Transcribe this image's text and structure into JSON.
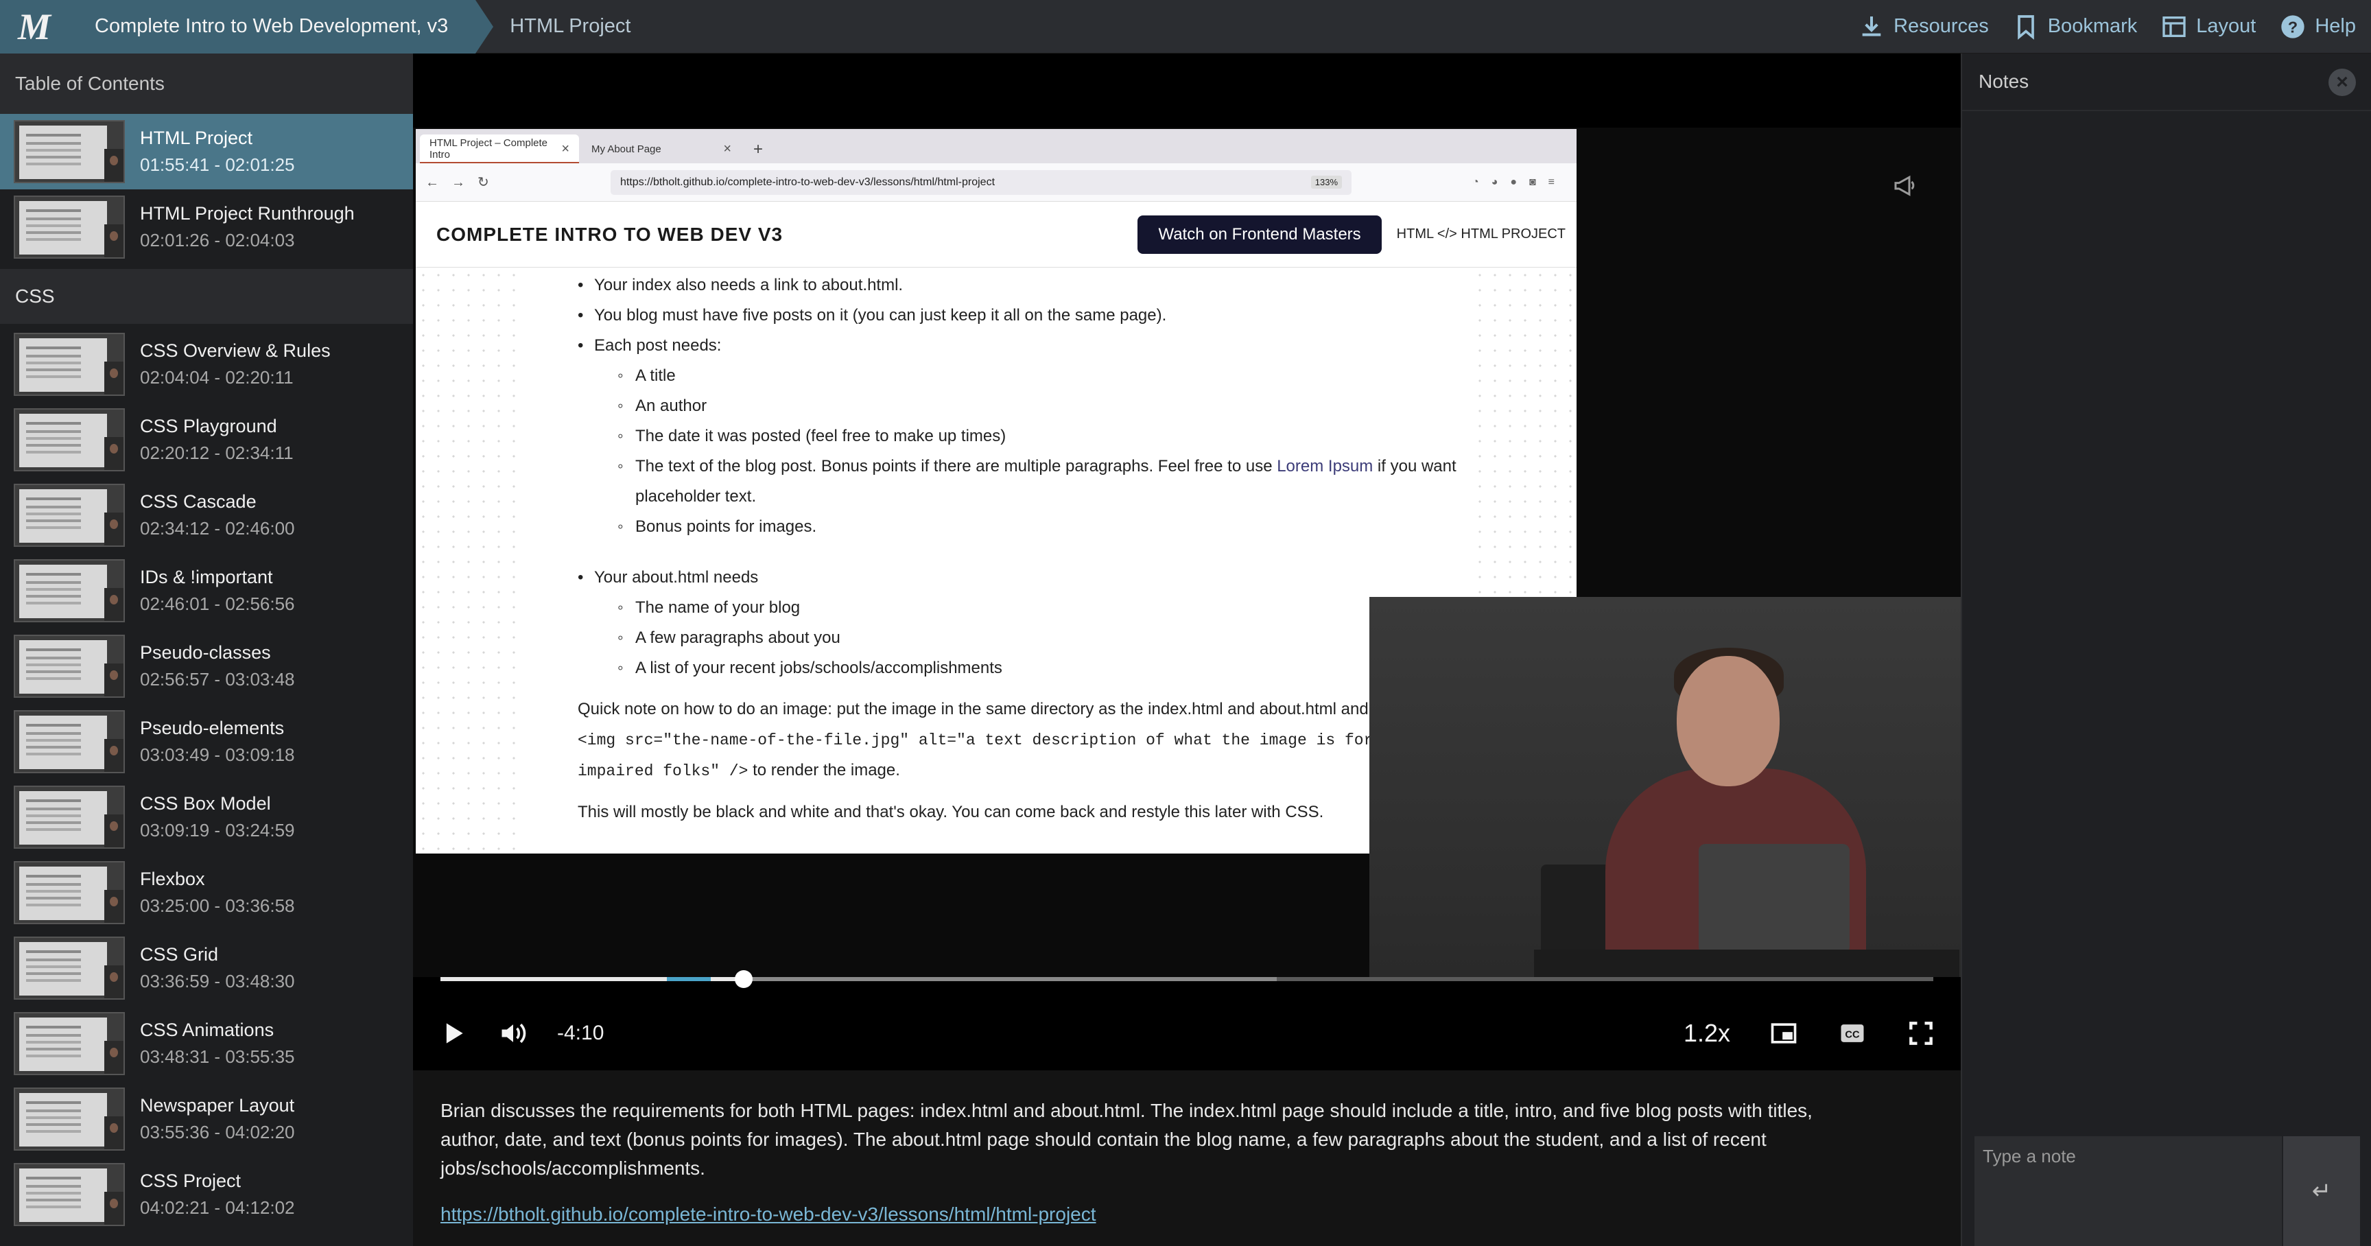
{
  "header": {
    "logo_text": "M",
    "course_title": "Complete Intro to Web Development, v3",
    "lesson_title": "HTML Project",
    "nav": [
      {
        "label": "Resources",
        "icon": "download-icon"
      },
      {
        "label": "Bookmark",
        "icon": "bookmark-icon"
      },
      {
        "label": "Layout",
        "icon": "layout-icon"
      },
      {
        "label": "Help",
        "icon": "help-icon"
      }
    ],
    "accent_color": "#3d6273"
  },
  "sidebar": {
    "heading": "Table of Contents",
    "lessons_top": [
      {
        "title": "HTML Project",
        "time": "01:55:41 - 02:01:25",
        "active": true
      },
      {
        "title": "HTML Project Runthrough",
        "time": "02:01:26 - 02:04:03",
        "active": false
      }
    ],
    "section": "CSS",
    "lessons": [
      {
        "title": "CSS Overview & Rules",
        "time": "02:04:04 - 02:20:11"
      },
      {
        "title": "CSS Playground",
        "time": "02:20:12 - 02:34:11"
      },
      {
        "title": "CSS Cascade",
        "time": "02:34:12 - 02:46:00"
      },
      {
        "title": "IDs & !important",
        "time": "02:46:01 - 02:56:56"
      },
      {
        "title": "Pseudo-classes",
        "time": "02:56:57 - 03:03:48"
      },
      {
        "title": "Pseudo-elements",
        "time": "03:03:49 - 03:09:18"
      },
      {
        "title": "CSS Box Model",
        "time": "03:09:19 - 03:24:59"
      },
      {
        "title": "Flexbox",
        "time": "03:25:00 - 03:36:58"
      },
      {
        "title": "CSS Grid",
        "time": "03:36:59 - 03:48:30"
      },
      {
        "title": "CSS Animations",
        "time": "03:48:31 - 03:55:35"
      },
      {
        "title": "Newspaper Layout",
        "time": "03:55:36 - 04:02:20"
      },
      {
        "title": "CSS Project",
        "time": "04:02:21 - 04:12:02"
      }
    ]
  },
  "video": {
    "browser": {
      "tabs": [
        "HTML Project – Complete Intro",
        "My About Page"
      ],
      "url": "https://btholt.github.io/complete-intro-to-web-dev-v3/lessons/html/html-project",
      "zoom": "133%"
    },
    "site": {
      "title": "COMPLETE INTRO TO WEB DEV V3",
      "watch_button": "Watch on Frontend Masters",
      "crumb": "HTML </> HTML PROJECT"
    },
    "doc": {
      "b1": "Your index also needs a link to about.html.",
      "b2": "You blog must have five posts on it (you can just keep it all on the same page).",
      "b3": "Each post needs:",
      "c1": "A title",
      "c2": "An author",
      "c3": "The date it was posted (feel free to make up times)",
      "c4_pre": "The text of the blog post. Bonus points if there are multiple paragraphs. Feel free to use ",
      "c4_link": "Lorem Ipsum",
      "c4_post": " if you want placeholder text.",
      "c5": "Bonus points for images.",
      "b4": "Your about.html needs",
      "d1": "The name of your blog",
      "d2": "A few paragraphs about you",
      "d3": "A list of your recent jobs/schools/accomplishments",
      "p1_pre": "Quick note on how to do an image: put the image in the same directory as the index.html and about.html and then put ",
      "p1_code": "<img src=\"the-name-of-the-file.jpg\" alt=\"a text description of what the image is for sight-impaired folks\" />",
      "p1_post": " to render the image.",
      "p2": "This will mostly be black and white and that's okay. You can come back and restyle this later with CSS."
    },
    "progress_fraction": 0.203,
    "time_remaining": "-4:10",
    "speed": "1.2x"
  },
  "description": {
    "text": "Brian discusses the requirements for both HTML pages: index.html and about.html. The index.html page should include a title, intro, and five blog posts with titles, author, date, and text (bonus points for images). The about.html page should contain the blog name, a few paragraphs about the student, and a list of recent jobs/schools/accomplishments.",
    "link": "https://btholt.github.io/complete-intro-to-web-dev-v3/lessons/html/html-project"
  },
  "notes": {
    "heading": "Notes",
    "placeholder": "Type a note",
    "submit_symbol": "↵"
  }
}
